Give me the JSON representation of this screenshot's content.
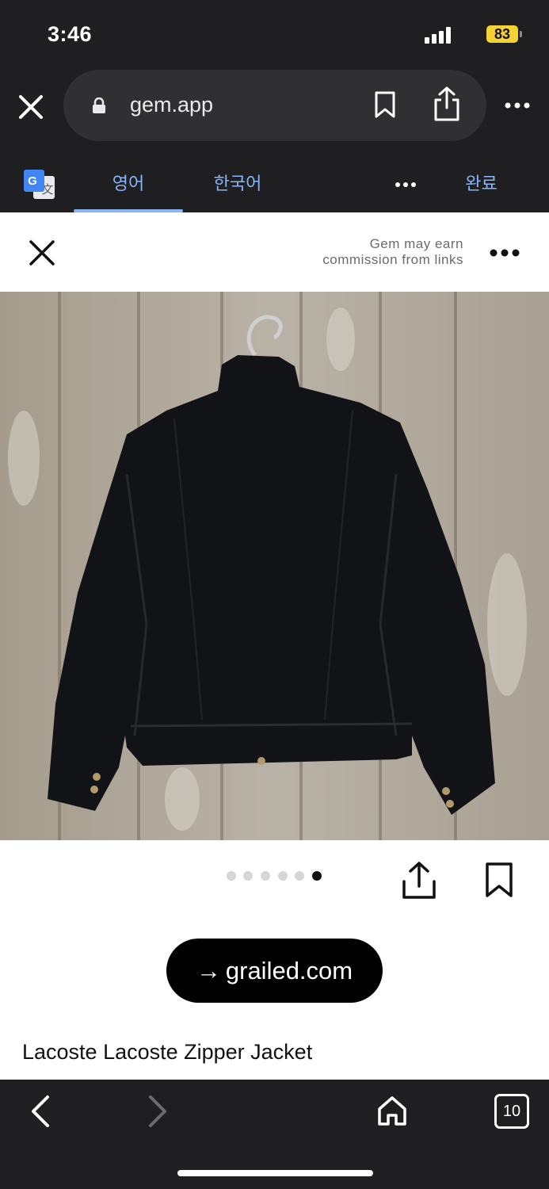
{
  "status": {
    "time": "3:46",
    "battery": "83"
  },
  "browser": {
    "url": "gem.app"
  },
  "translate": {
    "source_lang": "영어",
    "target_lang": "한국어",
    "done_label": "완료"
  },
  "sheet": {
    "disclaimer_line1": "Gem may earn",
    "disclaimer_line2": "commission from links"
  },
  "carousel": {
    "count": 6,
    "active_index": 5
  },
  "product": {
    "shop_arrow": "→",
    "shop_domain": "grailed.com",
    "title": "Lacoste Lacoste Zipper Jacket"
  },
  "tab_count": "10",
  "colors": {
    "browser_chrome": "#1f1f21",
    "url_pill": "#303033",
    "link_blue": "#8ab4f8",
    "battery_yellow": "#f4d233",
    "button_black": "#000000"
  },
  "icons": [
    "close-icon",
    "lock-icon",
    "bookmark-icon",
    "share-icon",
    "more-icon",
    "google-translate-icon",
    "back-icon",
    "forward-icon",
    "home-icon",
    "tabs-icon"
  ]
}
